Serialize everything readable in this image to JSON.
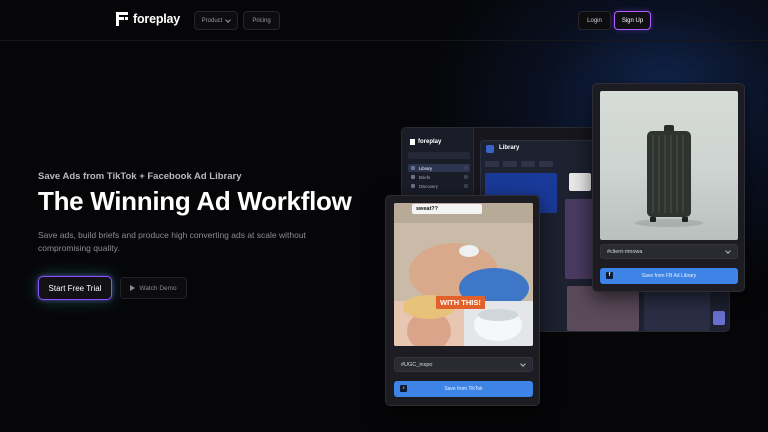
{
  "brand": {
    "name": "foreplay"
  },
  "nav": {
    "product_label": "Product",
    "pricing_label": "Pricing",
    "login_label": "Login",
    "signup_label": "Sign Up"
  },
  "hero": {
    "eyebrow": "Save Ads from TikTok + Facebook Ad Library",
    "headline": "The Winning Ad Workflow",
    "subtext": "Save ads, build briefs and produce high converting ads at scale without compromising quality.",
    "cta_primary": "Start Free Trial",
    "cta_secondary": "Watch Demo"
  },
  "app_mockup": {
    "logo": "foreplay",
    "title": "Library",
    "sidebar_items": [
      "Library",
      "Briefs",
      "Discovery"
    ]
  },
  "tiktok_card": {
    "caption_bubble": "sweat??",
    "overlay_text": "WITH THIS!",
    "board_tag": "#UGC_inspo",
    "save_label": "Save from TikTok"
  },
  "facebook_card": {
    "board_tag": "#client-rimowa",
    "save_label": "Save from FB Ad Library"
  },
  "colors": {
    "background": "#060608",
    "accent_purple": "#8a4fff",
    "save_blue": "#3d84e6"
  }
}
